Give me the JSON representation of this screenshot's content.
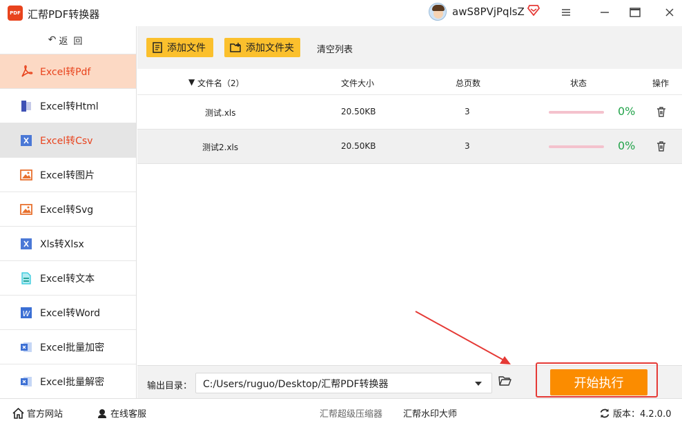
{
  "app": {
    "logo_text": "PDF",
    "title": "汇帮PDF转换器",
    "username": "awS8PVjPqlsZ"
  },
  "sidebar": {
    "back_label": "返回",
    "items": [
      {
        "label": "Excel转Pdf",
        "icon": "pdf-icon"
      },
      {
        "label": "Excel转Html",
        "icon": "html-icon"
      },
      {
        "label": "Excel转Csv",
        "icon": "excel-icon"
      },
      {
        "label": "Excel转图片",
        "icon": "image-icon"
      },
      {
        "label": "Excel转Svg",
        "icon": "image-icon"
      },
      {
        "label": "Xls转Xlsx",
        "icon": "excel-icon"
      },
      {
        "label": "Excel转文本",
        "icon": "text-file-icon"
      },
      {
        "label": "Excel转Word",
        "icon": "word-icon"
      },
      {
        "label": "Excel批量加密",
        "icon": "excel-lock-icon"
      },
      {
        "label": "Excel批量解密",
        "icon": "excel-unlock-icon"
      }
    ]
  },
  "toolbar": {
    "add_file": "添加文件",
    "add_folder": "添加文件夹",
    "clear_list": "清空列表"
  },
  "table": {
    "headers": {
      "name": "文件名（2）",
      "size": "文件大小",
      "pages": "总页数",
      "status": "状态",
      "action": "操作"
    },
    "rows": [
      {
        "name": "测试.xls",
        "size": "20.50KB",
        "pages": "3",
        "progress": 0,
        "status_text": "0%"
      },
      {
        "name": "测试2.xls",
        "size": "20.50KB",
        "pages": "3",
        "progress": 0,
        "status_text": "0%"
      }
    ]
  },
  "output": {
    "label": "输出目录：",
    "path": "C:/Users/ruguo/Desktop/汇帮PDF转换器",
    "start_label": "开始执行"
  },
  "footer": {
    "website": "官方网站",
    "service": "在线客服",
    "compress": "汇帮超级压缩器",
    "watermark": "汇帮水印大师",
    "version": "版本：4.2.0.0"
  },
  "colors": {
    "accent_orange": "#e8431d",
    "button_yellow": "#fbc02d",
    "start_orange": "#fb8c00",
    "highlight_red": "#e53935",
    "success_green": "#22a34a"
  }
}
